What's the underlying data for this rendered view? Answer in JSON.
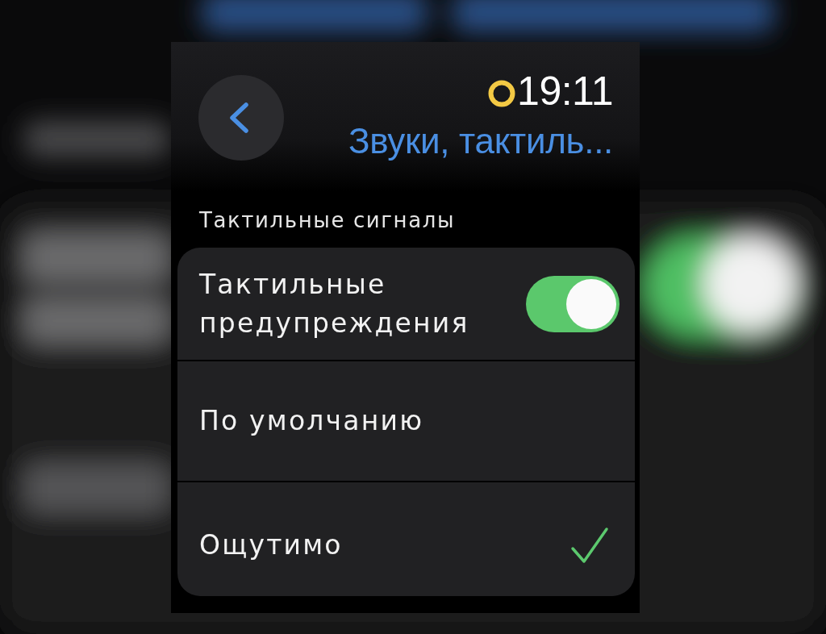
{
  "status": {
    "time": "19:11"
  },
  "nav": {
    "title": "Звуки, тактиль..."
  },
  "section": {
    "header": "Тактильные сигналы"
  },
  "rows": [
    {
      "kind": "toggle",
      "label": "Тактильные предупреждения",
      "on": true
    },
    {
      "kind": "option",
      "label": "По умолчанию",
      "selected": false
    },
    {
      "kind": "option",
      "label": "Ощутимо",
      "selected": true
    }
  ]
}
